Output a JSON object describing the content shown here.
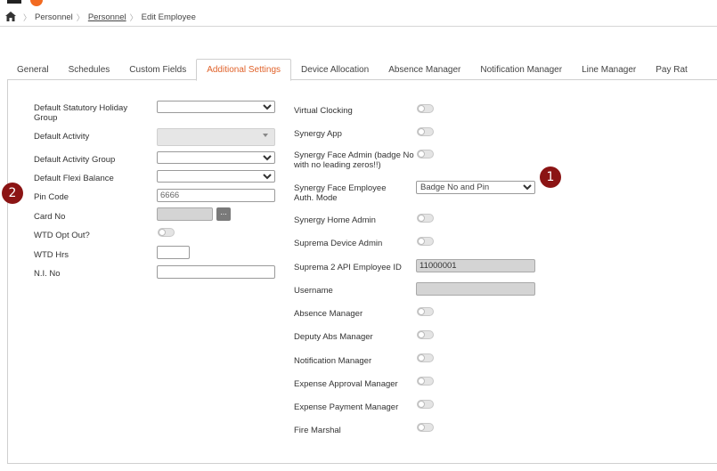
{
  "breadcrumb": {
    "items": [
      "Personnel",
      "Personnel",
      "Edit Employee"
    ]
  },
  "tabs": [
    "General",
    "Schedules",
    "Custom Fields",
    "Additional Settings",
    "Device Allocation",
    "Absence Manager",
    "Notification Manager",
    "Line Manager",
    "Pay Rat"
  ],
  "active_tab": "Additional Settings",
  "left": {
    "default_statutory_holiday_group": {
      "label": "Default Statutory Holiday Group",
      "value": ""
    },
    "default_activity": {
      "label": "Default Activity",
      "value": ""
    },
    "default_activity_group": {
      "label": "Default Activity Group",
      "value": ""
    },
    "default_flexi_balance": {
      "label": "Default Flexi Balance",
      "value": ""
    },
    "pin_code": {
      "label": "Pin Code",
      "value": "6666"
    },
    "card_no": {
      "label": "Card No",
      "value": "",
      "button": "..."
    },
    "wtd_opt_out": {
      "label": "WTD Opt Out?",
      "on": false
    },
    "wtd_hrs": {
      "label": "WTD Hrs",
      "value": ""
    },
    "ni_no": {
      "label": "N.I. No",
      "value": ""
    }
  },
  "right": {
    "virtual_clocking": {
      "label": "Virtual Clocking",
      "on": false
    },
    "synergy_app": {
      "label": "Synergy App",
      "on": false
    },
    "synergy_face_admin": {
      "label": "Synergy Face Admin (badge No with no leading zeros!!)",
      "on": false
    },
    "synergy_face_employee_auth": {
      "label": "Synergy Face Employee Auth. Mode",
      "value": "Badge No and Pin"
    },
    "synergy_home_admin": {
      "label": "Synergy Home Admin",
      "on": false
    },
    "suprema_device_admin": {
      "label": "Suprema Device Admin",
      "on": false
    },
    "suprema_2_api_employee_id": {
      "label": "Suprema 2 API Employee ID",
      "value": "11000001"
    },
    "username": {
      "label": "Username",
      "value": ""
    },
    "absence_manager": {
      "label": "Absence Manager",
      "on": false
    },
    "deputy_abs_manager": {
      "label": "Deputy Abs Manager",
      "on": false
    },
    "notification_manager": {
      "label": "Notification Manager",
      "on": false
    },
    "expense_approval_manager": {
      "label": "Expense Approval Manager",
      "on": false
    },
    "expense_payment_manager": {
      "label": "Expense Payment Manager",
      "on": false
    },
    "fire_marshal": {
      "label": "Fire Marshal",
      "on": false
    }
  },
  "callouts": [
    "1",
    "2"
  ],
  "colors": {
    "accent": "#e0622a",
    "callout": "#8b1414",
    "brand_orange": "#f26a21"
  }
}
